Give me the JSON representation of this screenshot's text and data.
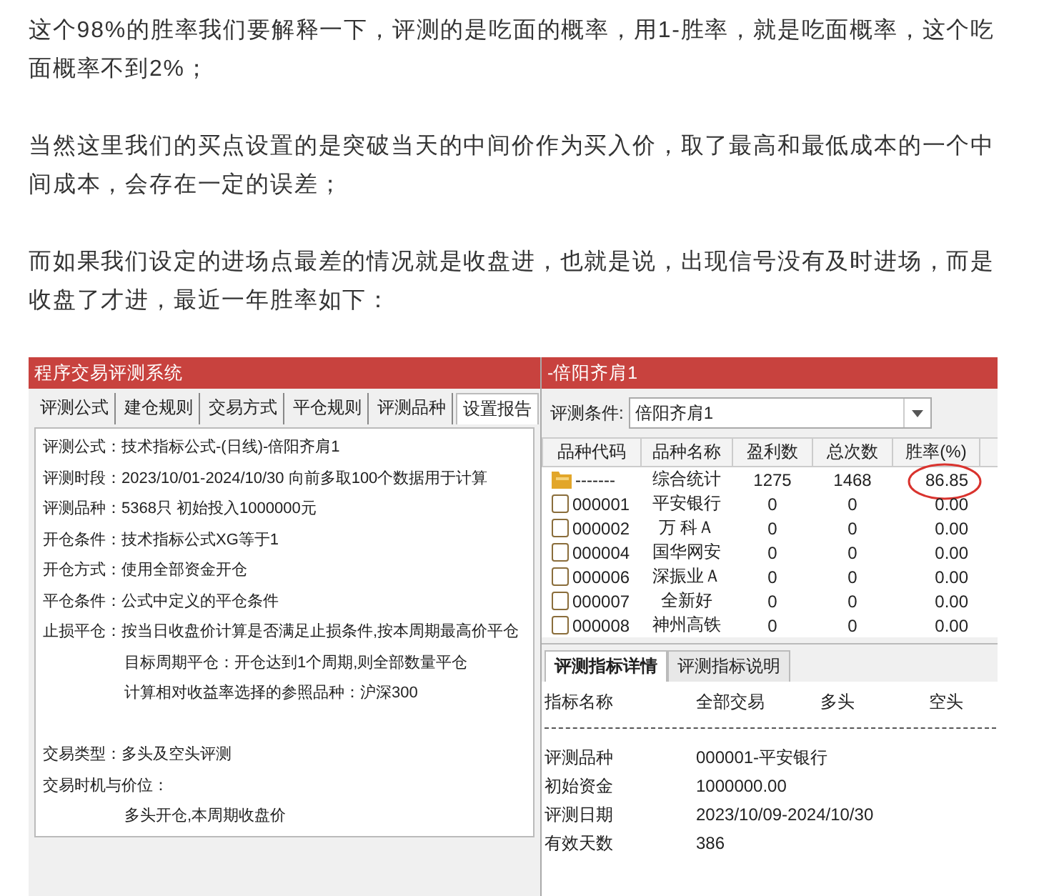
{
  "article": {
    "paragraphs": [
      "这个98%的胜率我们要解释一下，评测的是吃面的概率，用1-胜率，就是吃面概率，这个吃面概率不到2%；",
      "当然这里我们的买点设置的是突破当天的中间价作为买入价，取了最高和最低成本的一个中间成本，会存在一定的误差；",
      "而如果我们设定的进场点最差的情况就是收盘进，也就是说，出现信号没有及时进场，而是收盘了才进，最近一年胜率如下："
    ]
  },
  "left_window": {
    "title": "程序交易评测系统",
    "tabs": [
      {
        "label": "评测公式",
        "selected": false
      },
      {
        "label": "建仓规则",
        "selected": false
      },
      {
        "label": "交易方式",
        "selected": false
      },
      {
        "label": "平仓规则",
        "selected": false
      },
      {
        "label": "评测品种",
        "selected": false
      },
      {
        "label": "设置报告",
        "selected": true
      }
    ],
    "lines": [
      {
        "kind": "field",
        "label": "评测公式：",
        "value": "技术指标公式-(日线)-倍阳齐肩1"
      },
      {
        "kind": "field",
        "label": "评测时段：",
        "value": "2023/10/01-2024/10/30 向前多取100个数据用于计算"
      },
      {
        "kind": "field",
        "label": "评测品种：",
        "value": "5368只 初始投入1000000元"
      },
      {
        "kind": "field",
        "label": "开仓条件：",
        "value": "技术指标公式XG等于1"
      },
      {
        "kind": "field",
        "label": "开仓方式：",
        "value": "使用全部资金开仓"
      },
      {
        "kind": "field",
        "label": "平仓条件：",
        "value": "公式中定义的平仓条件"
      },
      {
        "kind": "field",
        "label": "止损平仓：",
        "value": "按当日收盘价计算是否满足止损条件,按本周期最高价平仓"
      },
      {
        "kind": "continuation",
        "value": "目标周期平仓：开仓达到1个周期,则全部数量平仓"
      },
      {
        "kind": "continuation",
        "value": "计算相对收益率选择的参照品种：沪深300"
      },
      {
        "kind": "blank"
      },
      {
        "kind": "field",
        "label": "交易类型：",
        "value": "多头及空头评测"
      },
      {
        "kind": "field",
        "label": "交易时机与价位："
      },
      {
        "kind": "continuation",
        "value": "多头开仓,本周期收盘价"
      }
    ]
  },
  "right_window": {
    "title": "-倍阳齐肩1",
    "condition": {
      "label": "评测条件:",
      "value": "倍阳齐肩1"
    },
    "columns": [
      "品种代码",
      "品种名称",
      "盈利数",
      "总次数",
      "胜率(%)"
    ],
    "rows": [
      {
        "kind": "summary",
        "code": "-------",
        "name": "综合统计",
        "wins": "1275",
        "total": "1468",
        "rate": "86.85",
        "circled": true
      },
      {
        "kind": "stock",
        "code": "000001",
        "name": "平安银行",
        "wins": "0",
        "total": "0",
        "rate": "0.00",
        "circled": false
      },
      {
        "kind": "stock",
        "code": "000002",
        "name": "万 科Ａ",
        "wins": "0",
        "total": "0",
        "rate": "0.00",
        "circled": false
      },
      {
        "kind": "stock",
        "code": "000004",
        "name": "国华网安",
        "wins": "0",
        "total": "0",
        "rate": "0.00",
        "circled": false
      },
      {
        "kind": "stock",
        "code": "000006",
        "name": "深振业Ａ",
        "wins": "0",
        "total": "0",
        "rate": "0.00",
        "circled": false
      },
      {
        "kind": "stock",
        "code": "000007",
        "name": "全新好",
        "wins": "0",
        "total": "0",
        "rate": "0.00",
        "circled": false
      },
      {
        "kind": "stock",
        "code": "000008",
        "name": "神州高铁",
        "wins": "0",
        "total": "0",
        "rate": "0.00",
        "circled": false
      }
    ],
    "detail_tabs": [
      {
        "label": "评测指标详情",
        "selected": true
      },
      {
        "label": "评测指标说明",
        "selected": false
      }
    ],
    "detail_header": [
      "指标名称",
      "全部交易",
      "多头",
      "空头"
    ],
    "detail_rows": [
      {
        "name": "评测品种",
        "value": "000001-平安银行"
      },
      {
        "name": "初始资金",
        "value": "1000000.00"
      },
      {
        "name": "评测日期",
        "value": "2023/10/09-2024/10/30"
      },
      {
        "name": "有效天数",
        "value": "386"
      }
    ]
  }
}
